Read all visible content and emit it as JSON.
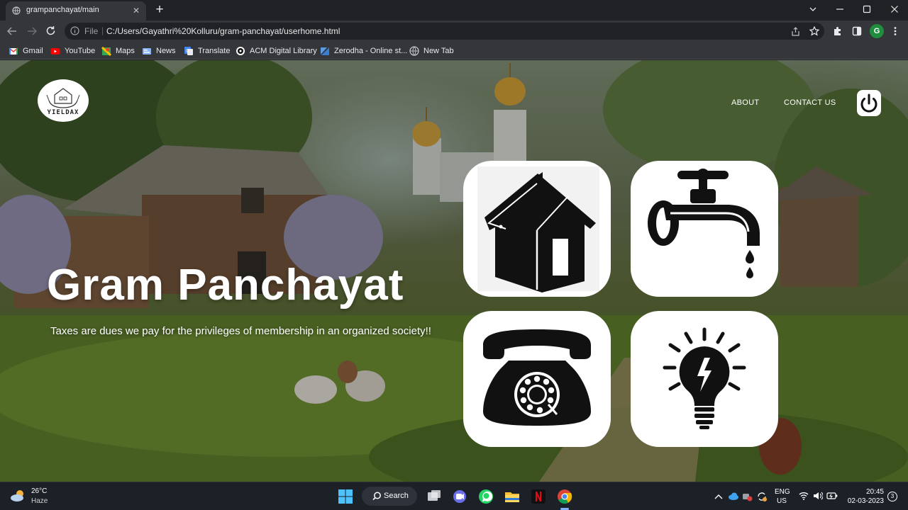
{
  "browser": {
    "tab_title": "grampanchayat/main",
    "tab_close": "✕",
    "new_tab": "+",
    "url_scheme": "File",
    "url_separator": "|",
    "url": "C:/Users/Gayathri%20Kolluru/gram-panchayat/userhome.html",
    "profile_initial": "G",
    "bookmarks": [
      {
        "label": "Gmail",
        "icon": "gmail-icon"
      },
      {
        "label": "YouTube",
        "icon": "youtube-icon"
      },
      {
        "label": "Maps",
        "icon": "maps-icon"
      },
      {
        "label": "News",
        "icon": "news-icon"
      },
      {
        "label": "Translate",
        "icon": "translate-icon"
      },
      {
        "label": "ACM Digital Library",
        "icon": "acm-icon"
      },
      {
        "label": "Zerodha - Online st...",
        "icon": "zerodha-icon"
      },
      {
        "label": "New Tab",
        "icon": "globe-icon"
      }
    ]
  },
  "page": {
    "logo_text": "YIELDAX",
    "nav": {
      "about": "ABOUT",
      "contact": "CONTACT US"
    },
    "title": "Gram Panchayat",
    "tagline": "Taxes are dues we pay for the privileges of membership in an organized society!!",
    "tiles": [
      {
        "name": "house-tax",
        "icon": "house-icon"
      },
      {
        "name": "water-tax",
        "icon": "water-tap-icon"
      },
      {
        "name": "telephone-bill",
        "icon": "telephone-icon"
      },
      {
        "name": "electricity-bill",
        "icon": "light-bulb-icon"
      }
    ]
  },
  "taskbar": {
    "weather_temp": "26°C",
    "weather_desc": "Haze",
    "search_label": "Search",
    "lang_top": "ENG",
    "lang_bottom": "US",
    "time": "20:45",
    "date": "02-03-2023",
    "notification_count": "3"
  },
  "colors": {
    "accent_green": "#1e8e3e",
    "chrome_dark": "#202124",
    "chrome_toolbar": "#35363a"
  }
}
